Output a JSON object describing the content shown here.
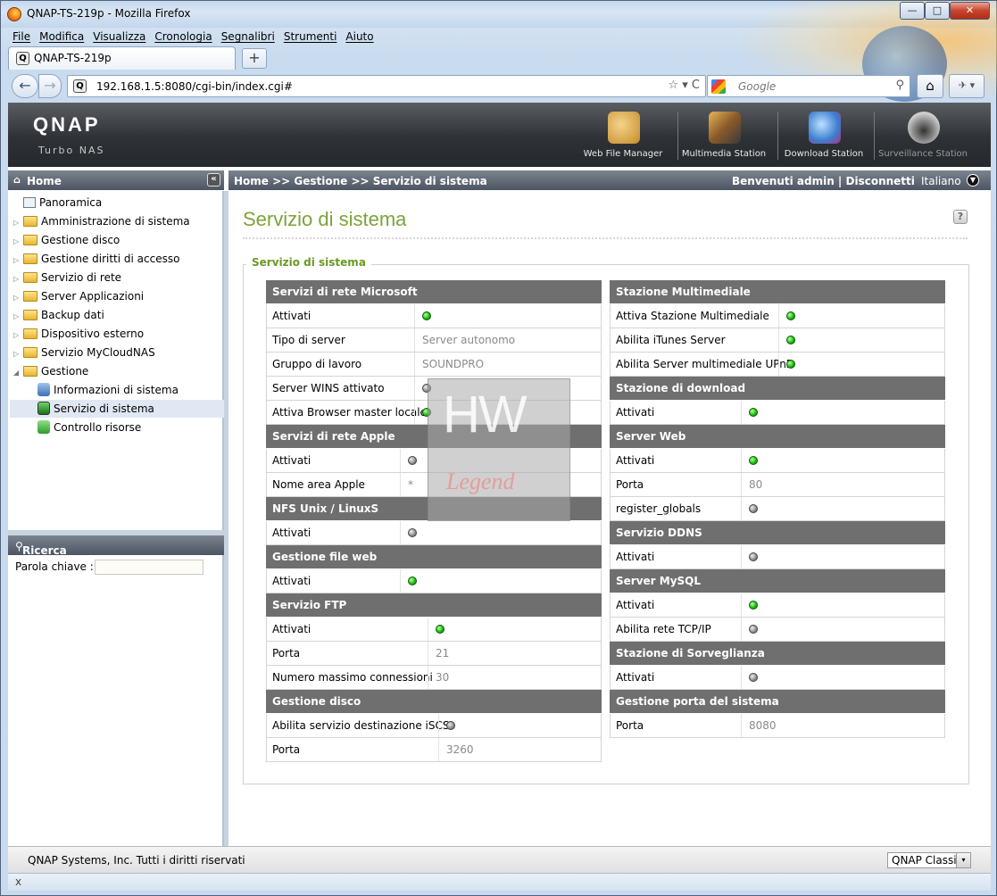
{
  "window": {
    "title": "QNAP-TS-219p - Mozilla Firefox",
    "min": "—",
    "max": "□",
    "close": "✕"
  },
  "menu": [
    "File",
    "Modifica",
    "Visualizza",
    "Cronologia",
    "Segnalibri",
    "Strumenti",
    "Aiuto"
  ],
  "tab": {
    "label": "QNAP-TS-219p",
    "icon": "Q",
    "new_tab": "+"
  },
  "nav": {
    "back": "←",
    "forward": "→",
    "url": "192.168.1.5:8080/cgi-bin/index.cgi#",
    "url_icon": "Q",
    "url_tools": "☆ ▾  C",
    "search_placeholder": "Google",
    "search_go": "⚲",
    "home": "⌂",
    "ext": "✈ ▾"
  },
  "qnap": {
    "logo": "QNAP",
    "subtitle": "Turbo NAS",
    "apps": [
      {
        "label": "Web File Manager",
        "color": "#d8a24a"
      },
      {
        "label": "Multimedia Station",
        "color": "#8a5a2a"
      },
      {
        "label": "Download Station",
        "color": "#3b7fd0"
      },
      {
        "label": "Surveillance Station",
        "color": "#9a9a9a"
      }
    ]
  },
  "left": {
    "home": "Home",
    "collapse": "«",
    "tree": [
      {
        "label": "Panoramica",
        "type": "doc"
      },
      {
        "label": "Amministrazione di sistema",
        "type": "folder"
      },
      {
        "label": "Gestione disco",
        "type": "folder"
      },
      {
        "label": "Gestione diritti di accesso",
        "type": "folder"
      },
      {
        "label": "Servizio di rete",
        "type": "folder"
      },
      {
        "label": "Server Applicazioni",
        "type": "folder"
      },
      {
        "label": "Backup dati",
        "type": "folder"
      },
      {
        "label": "Dispositivo esterno",
        "type": "folder"
      },
      {
        "label": "Servizio MyCloudNAS",
        "type": "folder"
      },
      {
        "label": "Gestione",
        "type": "folder-open"
      },
      {
        "label": "Informazioni di sistema",
        "type": "child"
      },
      {
        "label": "Servizio di sistema",
        "type": "child"
      },
      {
        "label": "Controllo risorse",
        "type": "child"
      }
    ],
    "search_title": "Ricerca funzione",
    "keyword_label": "Parola chiave :"
  },
  "topbar": {
    "breadcrumb": "Home >> Gestione >> Servizio di sistema",
    "welcome": "Benvenuti admin | Disconnetti",
    "language": "Italiano"
  },
  "content": {
    "title": "Servizio di sistema",
    "legend": "Servizio di sistema",
    "help": "?",
    "left_sections": [
      {
        "title": "Servizi di rete Microsoft",
        "rows": [
          {
            "label": "Attivati",
            "status": "on"
          },
          {
            "label": "Tipo di server",
            "value": "Server autonomo"
          },
          {
            "label": "Gruppo di lavoro",
            "value": "SOUNDPRO"
          },
          {
            "label": "Server WINS attivato",
            "status": "off"
          },
          {
            "label": "Attiva Browser master locale",
            "status": "on"
          }
        ]
      },
      {
        "title": "Servizi di rete Apple",
        "rows": [
          {
            "label": "Attivati",
            "status": "off"
          },
          {
            "label": "Nome area Apple",
            "value": "*"
          }
        ]
      },
      {
        "title": "NFS Unix / LinuxS",
        "rows": [
          {
            "label": "Attivati",
            "status": "off"
          }
        ]
      },
      {
        "title": "Gestione file web",
        "rows": [
          {
            "label": "Attivati",
            "status": "on"
          }
        ]
      },
      {
        "title": "Servizio FTP",
        "rows": [
          {
            "label": "Attivati",
            "status": "on"
          },
          {
            "label": "Porta",
            "value": "21"
          },
          {
            "label": "Numero massimo connessioni",
            "value": "30"
          }
        ]
      },
      {
        "title": "Gestione disco",
        "rows": [
          {
            "label": "Abilita servizio destinazione iSCSI",
            "status": "off"
          },
          {
            "label": "Porta",
            "value": "3260"
          }
        ]
      }
    ],
    "right_sections": [
      {
        "title": "Stazione Multimediale",
        "rows": [
          {
            "label": "Attiva Stazione Multimediale",
            "status": "on"
          },
          {
            "label": "Abilita iTunes Server",
            "status": "on"
          },
          {
            "label": "Abilita Server multimediale UPnP",
            "status": "on"
          }
        ]
      },
      {
        "title": "Stazione di download",
        "rows": [
          {
            "label": "Attivati",
            "status": "on"
          }
        ]
      },
      {
        "title": "Server Web",
        "rows": [
          {
            "label": "Attivati",
            "status": "on"
          },
          {
            "label": "Porta",
            "value": "80"
          },
          {
            "label": "register_globals",
            "status": "off"
          }
        ]
      },
      {
        "title": "Servizio DDNS",
        "rows": [
          {
            "label": "Attivati",
            "status": "off"
          }
        ]
      },
      {
        "title": "Server MySQL",
        "rows": [
          {
            "label": "Attivati",
            "status": "on"
          },
          {
            "label": "Abilita rete TCP/IP",
            "status": "off"
          }
        ]
      },
      {
        "title": "Stazione di Sorveglianza",
        "rows": [
          {
            "label": "Attivati",
            "status": "off"
          }
        ]
      },
      {
        "title": "Gestione porta del sistema",
        "rows": [
          {
            "label": "Porta",
            "value": "8080"
          }
        ]
      }
    ],
    "watermark": {
      "top": "HW",
      "bottom": "Legend"
    }
  },
  "footer": {
    "copyright": "QNAP Systems, Inc. Tutti i diritti riservati",
    "skin": "QNAP Classic",
    "skin_dd": "▾"
  },
  "status": {
    "close": "x"
  }
}
